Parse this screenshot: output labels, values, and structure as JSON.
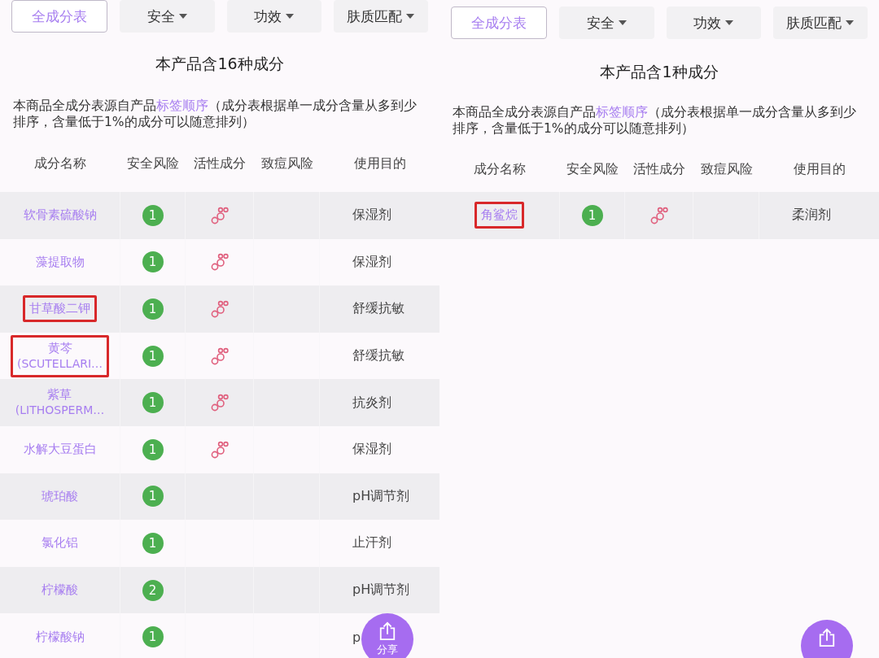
{
  "panels": [
    {
      "tabs": [
        {
          "label": "全成分表",
          "selected": true,
          "dropdown": false
        },
        {
          "label": "安全",
          "selected": false,
          "dropdown": true
        },
        {
          "label": "功效",
          "selected": false,
          "dropdown": true
        },
        {
          "label": "肤质匹配",
          "selected": false,
          "dropdown": true
        }
      ],
      "title": "本产品含16种成分",
      "note": {
        "before": "本商品全成分表源自产品",
        "link": "标签顺序",
        "after": "（成分表根据单一成分含量从多到少排序，含量低于1%的成分可以随意排列）"
      },
      "columns": [
        "成分名称",
        "安全风险",
        "活性成分",
        "致痘风险",
        "使用目的"
      ],
      "rows": [
        {
          "name": "软骨素硫酸钠",
          "risk": "1",
          "active": true,
          "purpose": "保湿剂",
          "highlighted": false
        },
        {
          "name": "藻提取物",
          "risk": "1",
          "active": true,
          "purpose": "保湿剂",
          "highlighted": false
        },
        {
          "name": "甘草酸二钾",
          "risk": "1",
          "active": true,
          "purpose": "舒缓抗敏",
          "highlighted": true
        },
        {
          "name": "黄芩",
          "latin": "(SCUTELLARI…",
          "risk": "1",
          "active": true,
          "purpose": "舒缓抗敏",
          "highlighted": true
        },
        {
          "name": "紫草",
          "latin": "(LITHOSPERM…",
          "risk": "1",
          "active": true,
          "purpose": "抗炎剂",
          "highlighted": false
        },
        {
          "name": "水解大豆蛋白",
          "risk": "1",
          "active": true,
          "purpose": "保湿剂",
          "highlighted": false
        },
        {
          "name": "琥珀酸",
          "risk": "1",
          "active": false,
          "purpose": "pH调节剂",
          "highlighted": false
        },
        {
          "name": "氯化铝",
          "risk": "1",
          "active": false,
          "purpose": "止汗剂",
          "highlighted": false
        },
        {
          "name": "柠檬酸",
          "risk": "2",
          "active": false,
          "purpose": "pH调节剂",
          "highlighted": false
        },
        {
          "name": "柠檬酸钠",
          "risk": "1",
          "active": false,
          "purpose": "p",
          "highlighted": false
        }
      ],
      "share": {
        "label": "分享"
      }
    },
    {
      "tabs": [
        {
          "label": "全成分表",
          "selected": true,
          "dropdown": false
        },
        {
          "label": "安全",
          "selected": false,
          "dropdown": true
        },
        {
          "label": "功效",
          "selected": false,
          "dropdown": true
        },
        {
          "label": "肤质匹配",
          "selected": false,
          "dropdown": true
        }
      ],
      "title": "本产品含1种成分",
      "note": {
        "before": "本商品全成分表源自产品",
        "link": "标签顺序",
        "after": "（成分表根据单一成分含量从多到少排序，含量低于1%的成分可以随意排列）"
      },
      "columns": [
        "成分名称",
        "安全风险",
        "活性成分",
        "致痘风险",
        "使用目的"
      ],
      "rows": [
        {
          "name": "角鲨烷",
          "risk": "1",
          "active": true,
          "purpose": "柔润剂",
          "highlighted": true
        }
      ]
    }
  ]
}
